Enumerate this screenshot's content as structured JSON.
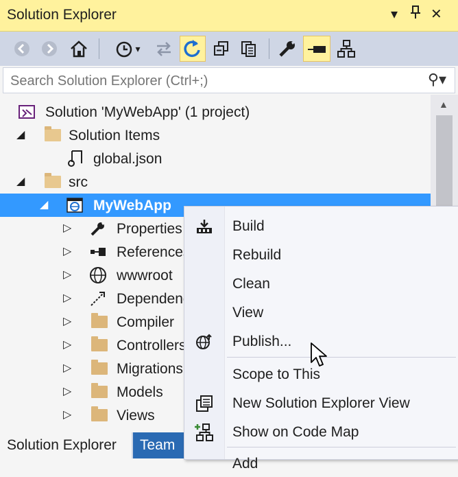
{
  "window": {
    "title": "Solution Explorer"
  },
  "search": {
    "placeholder": "Search Solution Explorer (Ctrl+;)"
  },
  "tree": {
    "solution_label": "Solution 'MyWebApp' (1 project)",
    "solution_items_label": "Solution Items",
    "global_json_label": "global.json",
    "src_label": "src",
    "project_label": "MyWebApp",
    "children": [
      "Properties",
      "References",
      "wwwroot",
      "Dependencies",
      "Compiler",
      "Controllers",
      "Migrations",
      "Models",
      "Views"
    ]
  },
  "context_menu": {
    "build": "Build",
    "rebuild": "Rebuild",
    "clean": "Clean",
    "view": "View",
    "publish": "Publish...",
    "scope": "Scope to This",
    "new_view": "New Solution Explorer View",
    "code_map": "Show on Code Map",
    "add": "Add"
  },
  "bottom_tabs": {
    "solution_explorer": "Solution Explorer",
    "team": "Team"
  },
  "colors": {
    "title_bar": "#fff29d",
    "toolbar": "#cfd6e5",
    "selection": "#3399ff",
    "folder": "#dcb67a",
    "inactive_tab": "#2a6ab3"
  }
}
